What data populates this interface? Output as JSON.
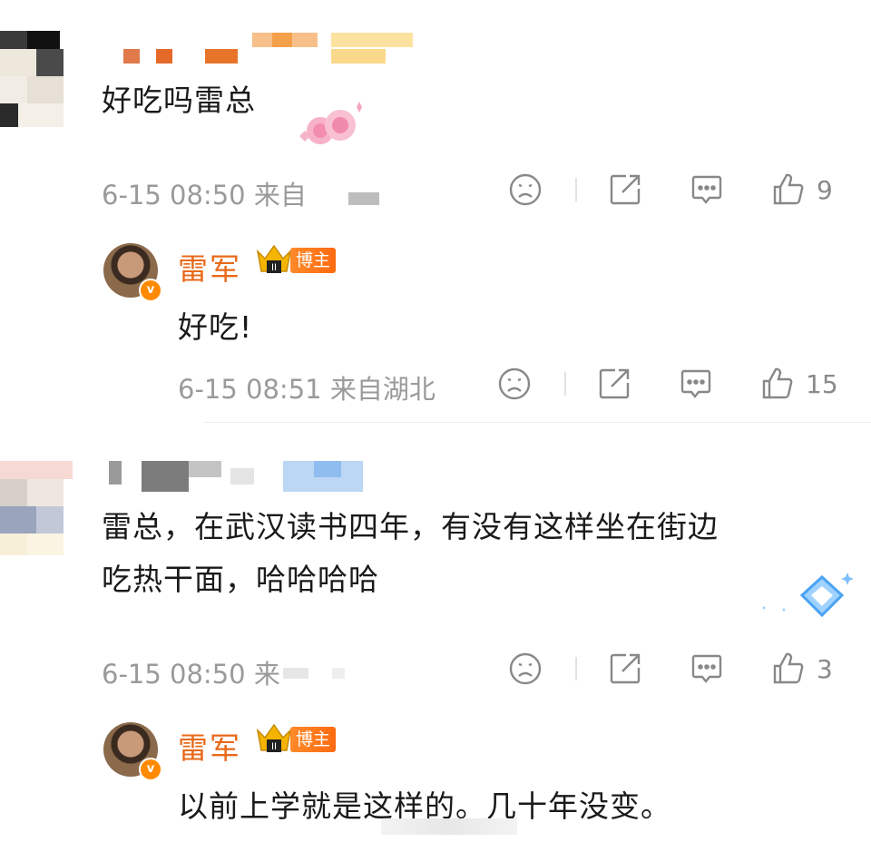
{
  "comments": [
    {
      "text": "好吃吗雷总",
      "time": "6-15 08:50",
      "source": "来自",
      "likes": "9",
      "reply": {
        "username": "雷军",
        "badge": "博主",
        "text": "好吃!",
        "time": "6-15 08:51",
        "source": "来自湖北",
        "likes": "15"
      }
    },
    {
      "text_line1": "雷总，在武汉读书四年，有没有这样坐在街边",
      "text_line2": "吃热干面，哈哈哈哈",
      "time": "6-15 08:50",
      "source": "来",
      "likes": "3",
      "reply": {
        "username": "雷军",
        "badge": "博主",
        "text": "以前上学就是这样的。几十年没变。"
      }
    }
  ],
  "icons": [
    "dislike-icon",
    "share-icon",
    "comment-icon",
    "like-icon"
  ],
  "colors": {
    "username": "#e86a1a",
    "meta": "#9a9a9a",
    "badge": "#ff7a1a"
  }
}
